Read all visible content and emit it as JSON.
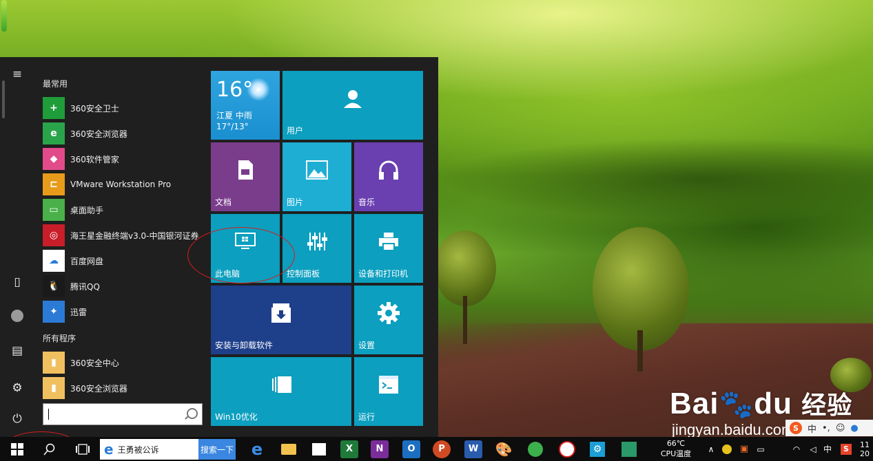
{
  "start_menu": {
    "most_used_title": "最常用",
    "all_programs_title": "所有程序",
    "most_used": [
      {
        "label": "360安全卫士",
        "color": "#1e9d3a",
        "glyph": "+"
      },
      {
        "label": "360安全浏览器",
        "color": "#2aa44a",
        "glyph": "e"
      },
      {
        "label": "360软件管家",
        "color": "#e24b8a",
        "glyph": "◆"
      },
      {
        "label": "VMware Workstation Pro",
        "color": "#e89b1a",
        "glyph": "⊏"
      },
      {
        "label": "桌面助手",
        "color": "#4ab04a",
        "glyph": "▭"
      },
      {
        "label": "海王星金融终端v3.0-中国银河证券",
        "color": "#c81e2a",
        "glyph": "◎"
      },
      {
        "label": "百度网盘",
        "color": "#ffffff",
        "glyph": "☁"
      },
      {
        "label": "腾讯QQ",
        "color": "#1a1a1a",
        "glyph": "🐧"
      },
      {
        "label": "迅雷",
        "color": "#2b7bd6",
        "glyph": "✦"
      }
    ],
    "all_programs": [
      {
        "label": "360安全中心",
        "color": "#f0c060",
        "glyph": "▮"
      },
      {
        "label": "360安全浏览器",
        "color": "#f0c060",
        "glyph": "▮"
      }
    ],
    "search_placeholder": ""
  },
  "tiles": {
    "weather": {
      "temp": "16°",
      "city": "江夏  中雨",
      "range": "17°/13°"
    },
    "user": "用户",
    "documents": "文档",
    "pictures": "图片",
    "music": "音乐",
    "this_pc": "此电脑",
    "control_panel": "控制面板",
    "devices_printers": "设备和打印机",
    "install_uninstall": "安装与卸载软件",
    "settings": "设置",
    "win10_optimize": "Win10优化",
    "run": "运行"
  },
  "taskbar": {
    "search_tab_label": "王勇被公诉",
    "search_button": "搜索一下",
    "cpu_temp": "66℃",
    "cpu_label": "CPU温度",
    "ime": "中",
    "clock_top": "11",
    "clock_bottom": "20"
  },
  "watermark": {
    "brand": "Bai",
    "brand2": "du",
    "cn": "经验",
    "url": "jingyan.baidu.com"
  },
  "colors": {
    "tile_teal": "#0c9fbf",
    "tile_purple": "#7a3d8c",
    "tile_violet": "#6a3fb0",
    "tile_navy": "#1e3f8a",
    "annotation": "#d81c1c"
  }
}
